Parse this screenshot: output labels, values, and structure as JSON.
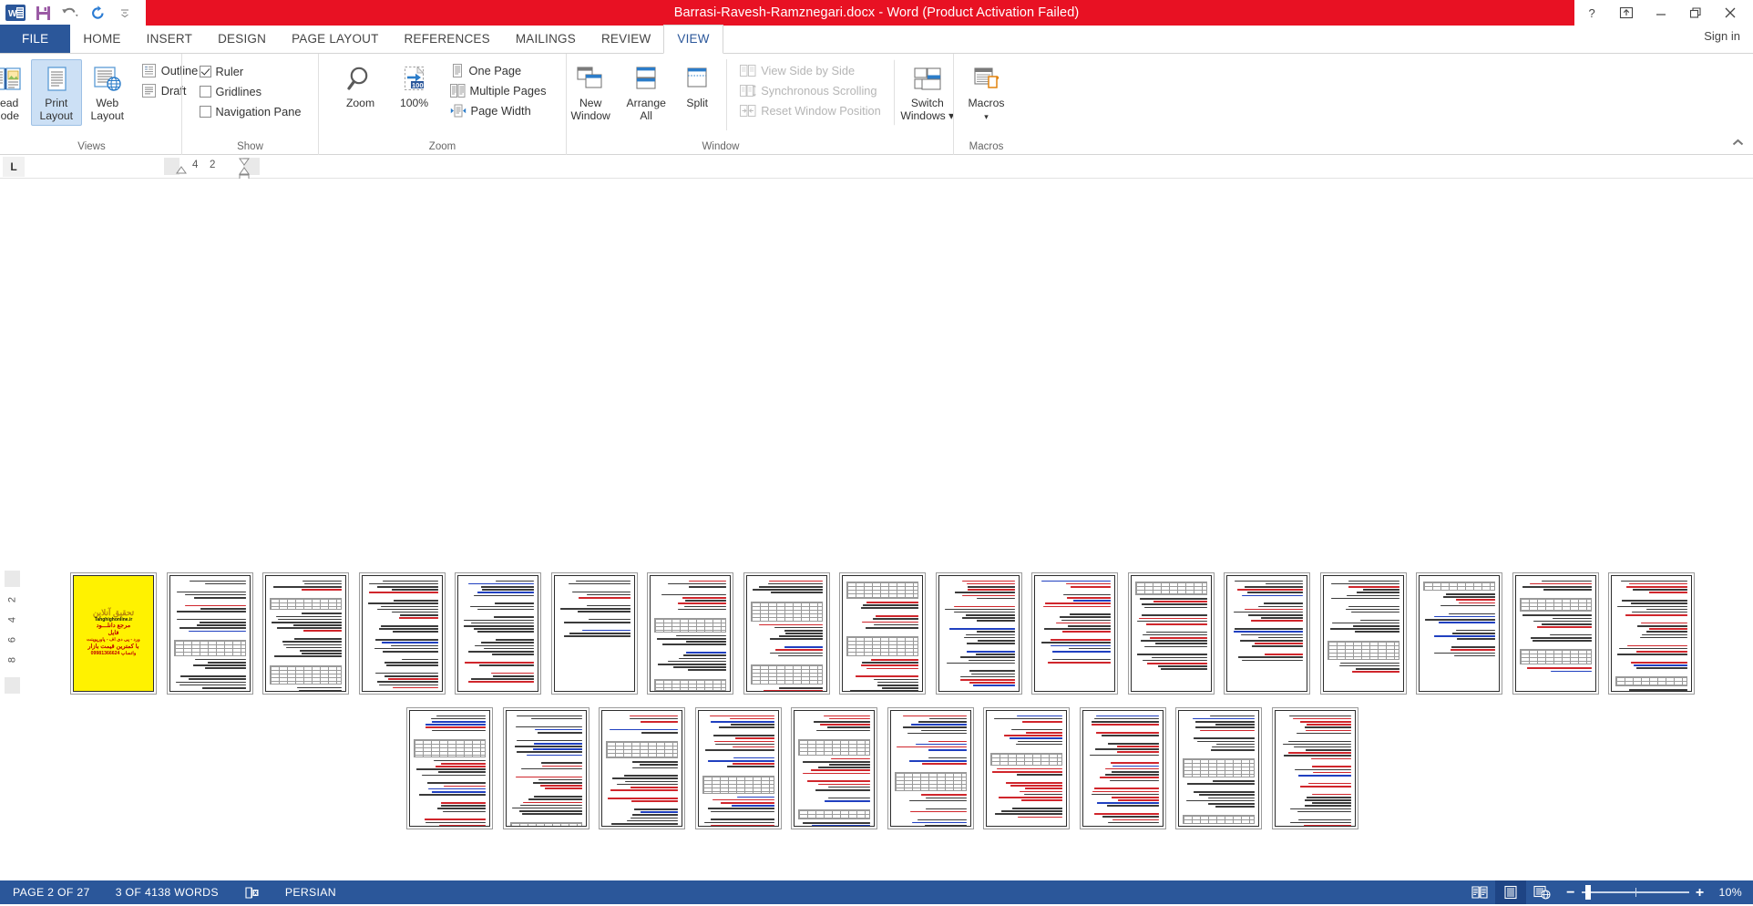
{
  "titlebar": {
    "document_title": "Barrasi-Ravesh-Ramznegari.docx  -  Word (Product Activation Failed)",
    "quick_access": [
      {
        "name": "save-icon",
        "label": "Save"
      },
      {
        "name": "undo-icon",
        "label": "Undo"
      },
      {
        "name": "redo-icon",
        "label": "Repeat"
      },
      {
        "name": "customize-qat-icon",
        "label": "Customize Quick Access Toolbar"
      }
    ],
    "window_controls": [
      {
        "name": "help-icon",
        "glyph": "?"
      },
      {
        "name": "ribbon-display-options-icon",
        "glyph": "⤒"
      },
      {
        "name": "minimize-icon",
        "glyph": "—"
      },
      {
        "name": "restore-icon",
        "glyph": "❐"
      },
      {
        "name": "close-icon",
        "glyph": "✕"
      }
    ],
    "sign_in": "Sign in"
  },
  "tabs": [
    {
      "label": "FILE",
      "active": false
    },
    {
      "label": "HOME",
      "active": false
    },
    {
      "label": "INSERT",
      "active": false
    },
    {
      "label": "DESIGN",
      "active": false
    },
    {
      "label": "PAGE LAYOUT",
      "active": false
    },
    {
      "label": "REFERENCES",
      "active": false
    },
    {
      "label": "MAILINGS",
      "active": false
    },
    {
      "label": "REVIEW",
      "active": false
    },
    {
      "label": "VIEW",
      "active": true
    }
  ],
  "ribbon": {
    "groups": [
      {
        "name": "views",
        "label": "Views",
        "big_buttons": [
          {
            "label_line1": "Read",
            "label_line2": "Mode",
            "selected": false
          },
          {
            "label_line1": "Print",
            "label_line2": "Layout",
            "selected": true
          },
          {
            "label_line1": "Web",
            "label_line2": "Layout",
            "selected": false
          }
        ],
        "small_buttons": [
          {
            "label": "Outline",
            "disabled": false
          },
          {
            "label": "Draft",
            "disabled": false
          }
        ]
      },
      {
        "name": "show",
        "label": "Show",
        "checkboxes": [
          {
            "label": "Ruler",
            "checked": true
          },
          {
            "label": "Gridlines",
            "checked": false
          },
          {
            "label": "Navigation Pane",
            "checked": false
          }
        ]
      },
      {
        "name": "zoom",
        "label": "Zoom",
        "big_buttons": [
          {
            "label_line1": "Zoom",
            "label_line2": ""
          },
          {
            "label_line1": "100%",
            "label_line2": ""
          }
        ],
        "small_buttons": [
          {
            "label": "One Page",
            "disabled": false
          },
          {
            "label": "Multiple Pages",
            "disabled": false
          },
          {
            "label": "Page Width",
            "disabled": false
          }
        ]
      },
      {
        "name": "window",
        "label": "Window",
        "big_buttons": [
          {
            "label_line1": "New",
            "label_line2": "Window"
          },
          {
            "label_line1": "Arrange",
            "label_line2": "All"
          },
          {
            "label_line1": "Split",
            "label_line2": ""
          },
          {
            "label_line1": "Switch",
            "label_line2": "Windows ▾"
          }
        ],
        "small_buttons": [
          {
            "label": "View Side by Side",
            "disabled": true
          },
          {
            "label": "Synchronous Scrolling",
            "disabled": true
          },
          {
            "label": "Reset Window Position",
            "disabled": true
          }
        ]
      },
      {
        "name": "macros",
        "label": "Macros",
        "big_buttons": [
          {
            "label_line1": "Macros",
            "label_line2": "▾"
          }
        ]
      }
    ],
    "collapse_icon": "▲"
  },
  "ruler": {
    "tab_stop_selector": "L",
    "horizontal_numbers": [
      "4",
      "2"
    ],
    "vertical_numbers": [
      "2",
      "4",
      "6",
      "8"
    ]
  },
  "document": {
    "zoom_level_percent": 10,
    "total_pages": 27,
    "row1_page_count": 17,
    "row2_page_count": 10,
    "cover_page": {
      "lines": [
        {
          "text": "تحقیق آنلاین",
          "style": "grey"
        },
        {
          "text": "Tahghighonline.ir",
          "style": "dark"
        },
        {
          "text": "مرجع دانلـــود",
          "style": "big"
        },
        {
          "text": "فایل",
          "style": "big"
        },
        {
          "text": "ورد - پی دی اف - پاورپوینت",
          "style": ""
        },
        {
          "text": "با کمترین قیمت بازار",
          "style": "big"
        },
        {
          "text": "09981366624 واتساپ",
          "style": ""
        }
      ]
    }
  },
  "statusbar": {
    "page_indicator": "PAGE 2 OF 27",
    "word_count": "3 OF 4138 WORDS",
    "proofing_icon": "proofing-errors-icon",
    "language": "PERSIAN",
    "view_buttons": [
      {
        "name": "read-mode-view-button",
        "active": false
      },
      {
        "name": "print-layout-view-button",
        "active": true
      },
      {
        "name": "web-layout-view-button",
        "active": false
      }
    ],
    "zoom_out": "−",
    "zoom_in": "+",
    "zoom_value": "10%"
  }
}
